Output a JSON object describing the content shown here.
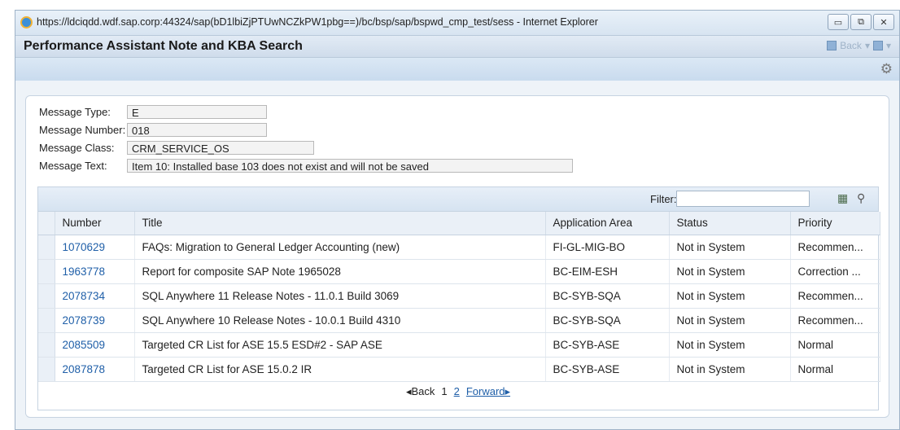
{
  "top_strip_text": "",
  "browser": {
    "title": "https://ldciqdd.wdf.sap.corp:44324/sap(bD1lbiZjPTUwNCZkPW1pbg==)/bc/bsp/sap/bspwd_cmp_test/sess - Internet Explorer",
    "minimize": "▭",
    "restore": "⧉",
    "close": "✕"
  },
  "app": {
    "title": "Performance Assistant Note and KBA Search",
    "back_label": "Back",
    "colors": {
      "accent": "#1f5fa8",
      "header_bg": "#d7e4f1"
    }
  },
  "message": {
    "type_label": "Message Type:",
    "type_value": "E",
    "number_label": "Message Number:",
    "number_value": "018",
    "class_label": "Message Class:",
    "class_value": "CRM_SERVICE_OS",
    "text_label": "Message Text:",
    "text_value": "Item 10: Installed base 103 does not exist and will not be saved"
  },
  "filter": {
    "label": "Filter:",
    "value": "",
    "export_icon": "export-excel-icon",
    "search_icon": "search-settings-icon"
  },
  "table": {
    "columns": [
      "Number",
      "Title",
      "Application Area",
      "Status",
      "Priority"
    ],
    "rows": [
      [
        "1070629",
        "FAQs: Migration to General Ledger Accounting (new)",
        "FI-GL-MIG-BO",
        "Not in System",
        "Recommen..."
      ],
      [
        "1963778",
        "Report for composite SAP Note 1965028",
        "BC-EIM-ESH",
        "Not in System",
        "Correction ..."
      ],
      [
        "2078734",
        "SQL Anywhere 11 Release Notes - 11.0.1 Build 3069",
        "BC-SYB-SQA",
        "Not in System",
        "Recommen..."
      ],
      [
        "2078739",
        "SQL Anywhere 10 Release Notes - 10.0.1 Build 4310",
        "BC-SYB-SQA",
        "Not in System",
        "Recommen..."
      ],
      [
        "2085509",
        "Targeted CR List for ASE 15.5 ESD#2 - SAP ASE",
        "BC-SYB-ASE",
        "Not in System",
        "Normal"
      ],
      [
        "2087878",
        "Targeted CR List for ASE 15.0.2 IR",
        "BC-SYB-ASE",
        "Not in System",
        "Normal"
      ]
    ]
  },
  "pager": {
    "back": "◂Back",
    "page1": "1",
    "page2": "2",
    "forward": "Forward▸"
  }
}
